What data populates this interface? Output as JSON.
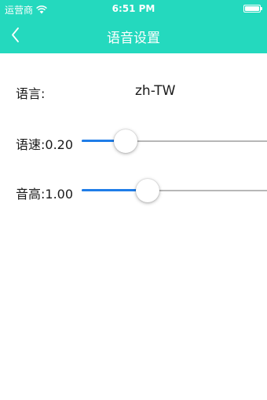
{
  "status_bar": {
    "carrier": "运营商",
    "time": "6:51 PM",
    "icons": [
      "wifi-icon",
      "battery-icon"
    ]
  },
  "nav": {
    "title": "语音设置",
    "back_icon": "chevron-left-icon"
  },
  "settings": {
    "language": {
      "label": "语言:",
      "value": "zh-TW"
    },
    "rate": {
      "label": "语速:0.20",
      "value": 0.2,
      "min": 0,
      "max": 1
    },
    "pitch": {
      "label": "音高:1.00",
      "value": 1.0,
      "min": 0.5,
      "max": 2.0
    }
  },
  "colors": {
    "header": "#24d9be",
    "slider_fill": "#1f7de8",
    "slider_track": "#b7b7b7"
  }
}
